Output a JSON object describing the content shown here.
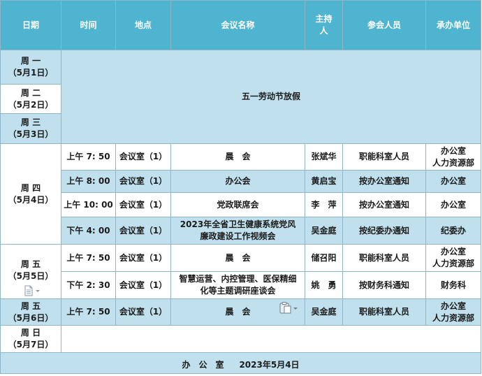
{
  "header": [
    "日期",
    "时间",
    "地点",
    "会议名称",
    "主持人",
    "参会人员",
    "承办单位"
  ],
  "days": {
    "mon": [
      "周 一",
      "（5月1日）"
    ],
    "tue": [
      "周 二",
      "（5月2日）"
    ],
    "wed": [
      "周 三",
      "（5月3日）"
    ],
    "thu": [
      "周 四",
      "（5月4日）"
    ],
    "fri": [
      "周 五",
      "（5月5日）"
    ],
    "sat": [
      "周 五",
      "（5月6日）"
    ],
    "sun": [
      "周 日",
      "（5月7日）"
    ]
  },
  "holiday": "五一劳动节放假",
  "rows": [
    {
      "time": "上午 7: 50",
      "place": "会议室（1）",
      "name": [
        "晨　会"
      ],
      "host": "张斌华",
      "attendees": "职能科室人员",
      "units": [
        "办公室",
        "人力资源部"
      ]
    },
    {
      "time": "上午 8: 00",
      "place": "会议室（1）",
      "name": [
        "办公会"
      ],
      "host": "黄启宝",
      "attendees": "按办公室通知",
      "units": [
        "办公室"
      ]
    },
    {
      "time": "上午 10: 00",
      "place": "会议室（1）",
      "name": [
        "党政联席会"
      ],
      "host": "李　萍",
      "attendees": "按办公室通知",
      "units": [
        "办公室"
      ]
    },
    {
      "time": "下午 4: 00",
      "place": "会议室（1）",
      "name": [
        "2023年全省卫生健康系统党风",
        "廉政建设工作视频会"
      ],
      "host": "吴金庭",
      "attendees": "按纪委办通知",
      "units": [
        "纪委办"
      ]
    },
    {
      "time": "上午 7: 50",
      "place": "会议室（1）",
      "name": [
        "晨　会"
      ],
      "host": "储召阳",
      "attendees": "职能科室人员",
      "units": [
        "办公室",
        "人力资源部"
      ]
    },
    {
      "time": "下午 2: 30",
      "place": "会议室（1）",
      "name": [
        "智慧运营、内控管理、医保精细",
        "化等主题调研座谈会"
      ],
      "host": "姚　勇",
      "attendees": "按财务科通知",
      "units": [
        "财务科"
      ]
    },
    {
      "time": "上午 7: 50",
      "place": "会议室（1）",
      "name": [
        "晨　会"
      ],
      "host": "吴金庭",
      "attendees": "职能科室人员",
      "units": [
        "办公室",
        "人力资源部"
      ]
    }
  ],
  "footer": {
    "office": "办　公　室",
    "date": "2023年5月4日"
  }
}
